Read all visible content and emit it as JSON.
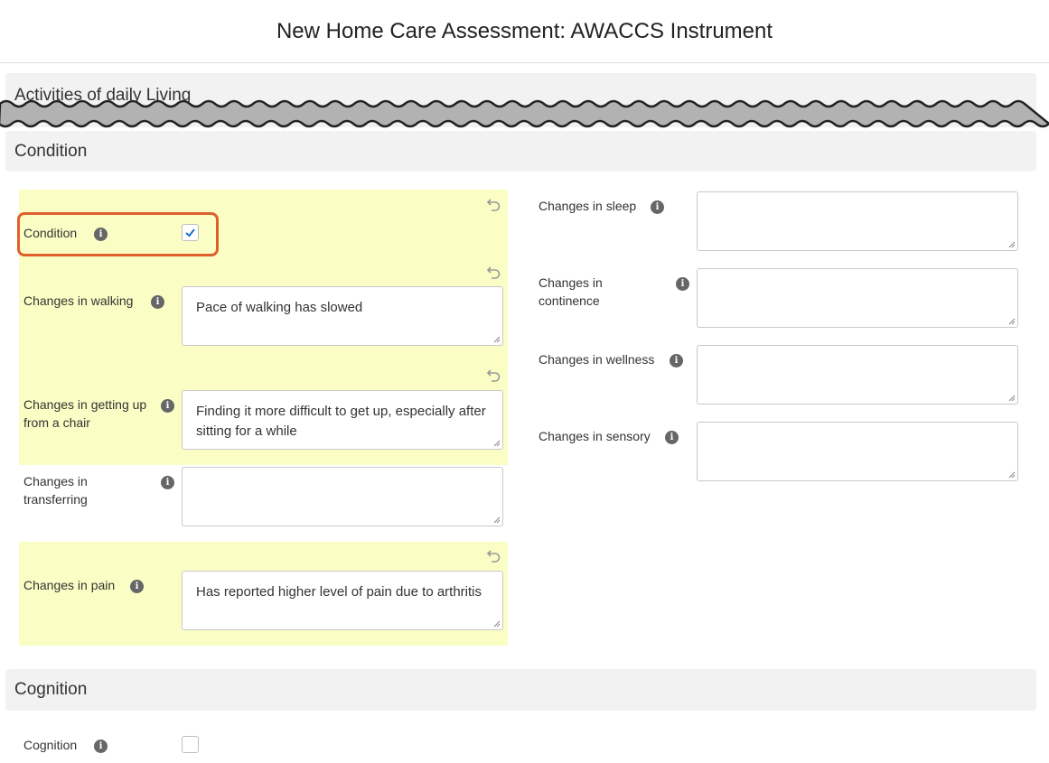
{
  "header": {
    "title": "New Home Care Assessment: AWACCS Instrument"
  },
  "sections": {
    "adl": "Activities of daily Living",
    "condition": "Condition",
    "cognition": "Cognition"
  },
  "condition_fields": {
    "condition": {
      "label": "Condition",
      "checked": true
    },
    "walking": {
      "label": "Changes in walking",
      "value": "Pace of walking has slowed"
    },
    "getting_up": {
      "label": "Changes in getting up from a chair",
      "value": "Finding it more difficult to get up, especially after sitting for a while"
    },
    "transferring": {
      "label": "Changes in transferring",
      "value": ""
    },
    "pain": {
      "label": "Changes in pain",
      "value": "Has reported higher level of pain due to arthritis"
    },
    "sleep": {
      "label": "Changes in sleep",
      "value": ""
    },
    "continence": {
      "label": "Changes in continence",
      "value": ""
    },
    "wellness": {
      "label": "Changes in wellness",
      "value": ""
    },
    "sensory": {
      "label": "Changes in sensory",
      "value": ""
    }
  },
  "cognition_fields": {
    "cognition": {
      "label": "Cognition",
      "checked": false
    }
  },
  "icons": {
    "info": "info-icon",
    "undo": "undo-icon",
    "check": "checkmark-icon"
  },
  "colors": {
    "highlight": "#fafec4",
    "focus_outline": "#e0602a",
    "check": "#1a73c8"
  }
}
